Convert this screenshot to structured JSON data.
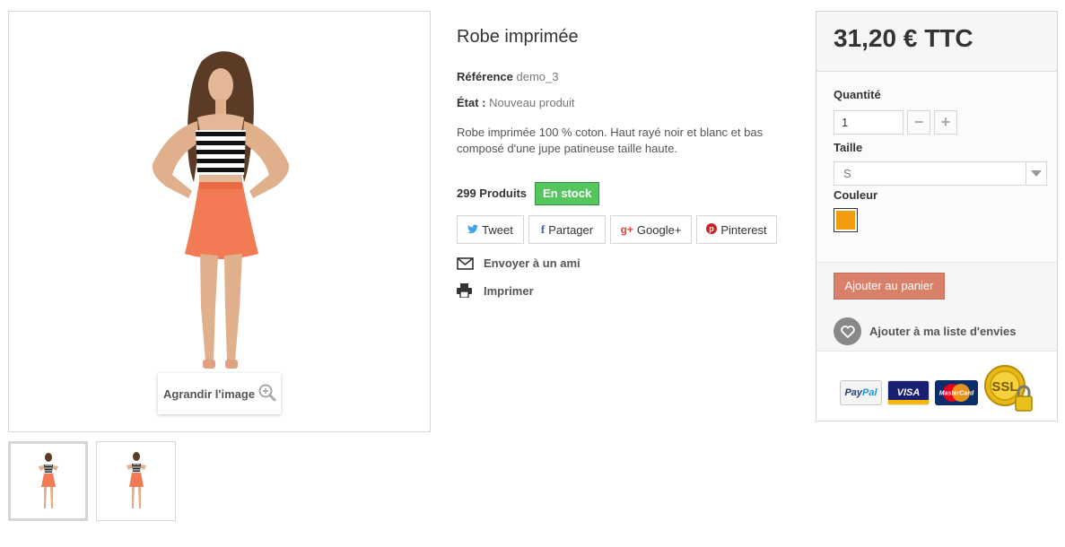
{
  "gallery": {
    "zoom_label": "Agrandir l'image"
  },
  "product": {
    "title": "Robe imprimée",
    "reference_label": "Référence",
    "reference_value": "demo_3",
    "condition_label": "État :",
    "condition_value": "Nouveau produit",
    "description": "Robe imprimée 100 % coton. Haut rayé noir et blanc et bas composé d'une jupe patineuse taille haute.",
    "quantity_text": "299 Produits",
    "stock_badge": "En stock",
    "stock_color": "#55c65e"
  },
  "share": {
    "twitter": "Tweet",
    "facebook": "Partager",
    "googleplus": "Google+",
    "pinterest": "Pinterest"
  },
  "links": {
    "send_friend": "Envoyer à un ami",
    "print": "Imprimer"
  },
  "buybox": {
    "price": "31,20 € TTC",
    "quantity_label": "Quantité",
    "quantity_value": "1",
    "minus": "−",
    "plus": "+",
    "size_label": "Taille",
    "size_value": "S",
    "color_label": "Couleur",
    "selected_color": "#f39c11",
    "add_to_cart": "Ajouter au panier",
    "cart_button_color": "#d9806b",
    "wishlist": "Ajouter à ma liste d'envies"
  },
  "payments": {
    "paypal_a": "Pay",
    "paypal_b": "Pal",
    "visa": "VISA",
    "mastercard": "MasterCard",
    "ssl": "SSL"
  }
}
